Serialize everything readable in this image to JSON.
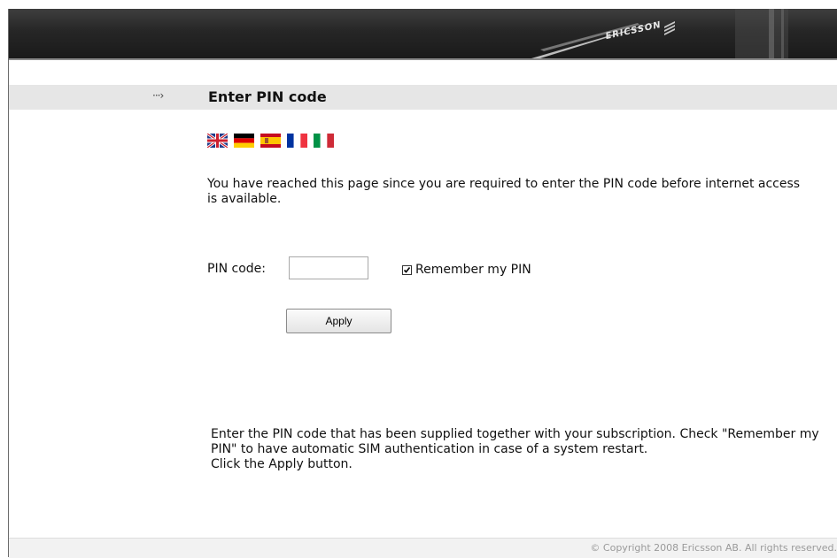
{
  "header": {
    "logo_text": "ERICSSON"
  },
  "title_bar": {
    "arrow": "···›",
    "title": "Enter PIN code"
  },
  "languages": [
    {
      "code": "en",
      "icon": "uk-flag-icon"
    },
    {
      "code": "de",
      "icon": "german-flag-icon"
    },
    {
      "code": "es",
      "icon": "spanish-flag-icon"
    },
    {
      "code": "fr",
      "icon": "french-flag-icon"
    },
    {
      "code": "it",
      "icon": "italian-flag-icon"
    }
  ],
  "intro": "You have reached this page since you are required to enter the PIN code before internet access is available.",
  "form": {
    "pin_label": "PIN code:",
    "pin_value": "",
    "remember_label": "Remember my PIN",
    "remember_checked": true,
    "apply_label": "Apply"
  },
  "help": {
    "line1": "Enter the PIN code that has been supplied together with your subscription. Check \"Remember my PIN\" to have automatic SIM authentication in case of a system restart.",
    "line2": "Click the Apply button."
  },
  "footer": {
    "copyright": "© Copyright 2008 Ericsson AB. All rights reserved."
  },
  "colors": {
    "header_dark": "#262626",
    "title_bar": "#e6e6e6",
    "footer_text": "#9a9a9a"
  }
}
